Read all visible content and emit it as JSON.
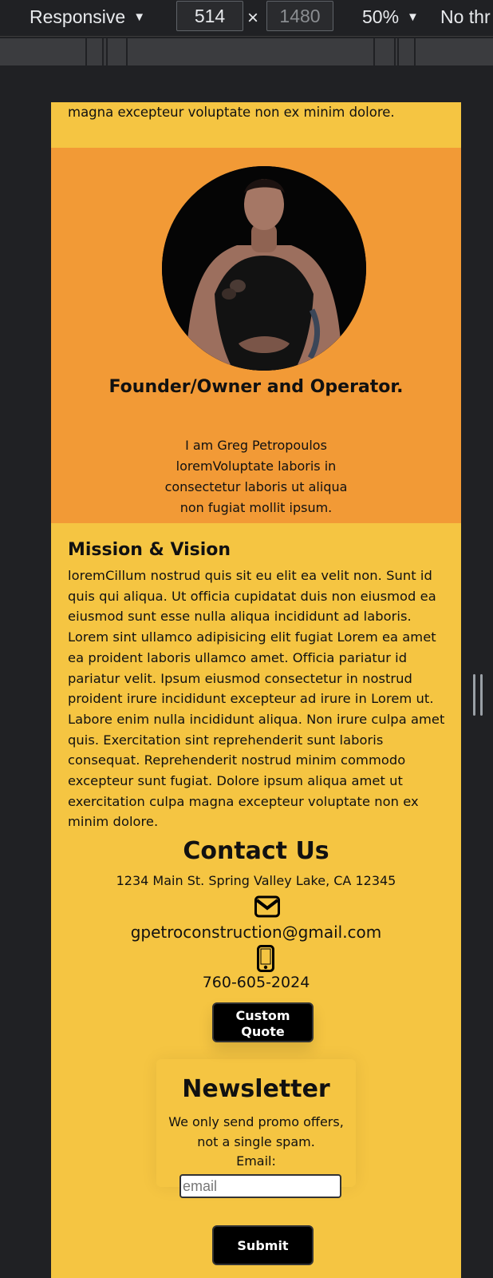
{
  "devtools": {
    "device": "Responsive",
    "width": "514",
    "times": "×",
    "height": "1480",
    "zoom": "50%",
    "throttle": "No thr",
    "caret": "▼"
  },
  "page": {
    "top_text": "magna excepteur voluptate non ex minim dolore.",
    "founder": {
      "title": "Founder/Owner and Operator.",
      "text": "I am Greg Petropoulos loremVoluptate laboris in consectetur laboris ut aliqua non fugiat mollit ipsum."
    },
    "mission": {
      "title": "Mission & Vision",
      "text": "loremCillum nostrud quis sit eu elit ea velit non. Sunt id quis qui aliqua. Ut officia cupidatat duis non eiusmod ea eiusmod sunt esse nulla aliqua incididunt ad laboris. Lorem sint ullamco adipisicing elit fugiat Lorem ea amet ea proident laboris ullamco amet. Officia pariatur id pariatur velit. Ipsum eiusmod consectetur in nostrud proident irure incididunt excepteur ad irure in Lorem ut. Labore enim nulla incididunt aliqua. Non irure culpa amet quis. Exercitation sint reprehenderit sunt laboris consequat. Reprehenderit nostrud minim commodo excepteur sunt fugiat. Dolore ipsum aliqua amet ut exercitation culpa magna excepteur voluptate non ex minim dolore."
    },
    "contact": {
      "title": "Contact Us",
      "address": "1234 Main St. Spring Valley Lake, CA 12345",
      "email_icon": "envelope-icon",
      "email": "gpetroconstruction@gmail.com",
      "phone_icon": "mobile-phone-icon",
      "phone": "760-605-2024",
      "quote_button": "Custom Quote"
    },
    "newsletter": {
      "title": "Newsletter",
      "text": "We only send promo offers, not a single spam.",
      "email_label": "Email:",
      "email_placeholder": "email",
      "submit_button": "Submit"
    }
  },
  "colors": {
    "page_background": "#f5c542",
    "founder_background": "#f29a36",
    "devtools_background": "#202124",
    "button_background": "#000000"
  }
}
